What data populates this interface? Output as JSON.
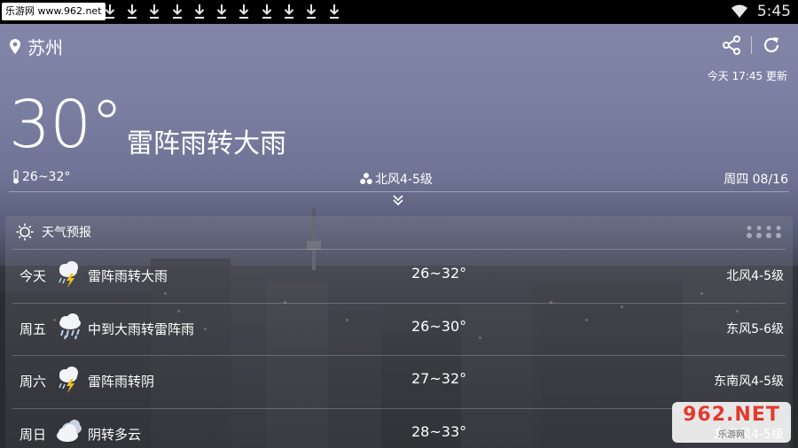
{
  "statusbar": {
    "watermark_url": "乐游网 www.962.net",
    "time": "5:45",
    "download_count": 11
  },
  "header": {
    "city": "苏州",
    "updated": "今天 17:45 更新"
  },
  "current": {
    "temp": "30°",
    "condition": "雷阵雨转大雨",
    "range": "26~32°",
    "wind": "北风4-5级",
    "date": "周四 08/16"
  },
  "forecast": {
    "title": "天气预报",
    "rows": [
      {
        "day": "今天",
        "icon": "thunderstorm-icon",
        "desc": "雷阵雨转大雨",
        "temp": "26~32°",
        "wind": "北风4-5级"
      },
      {
        "day": "周五",
        "icon": "heavy-rain-icon",
        "desc": "中到大雨转雷阵雨",
        "temp": "26~30°",
        "wind": "东风5-6级"
      },
      {
        "day": "周六",
        "icon": "thunderstorm-icon",
        "desc": "雷阵雨转阴",
        "temp": "27~32°",
        "wind": "东南风4-5级"
      },
      {
        "day": "周日",
        "icon": "cloudy-icon",
        "desc": "阴转多云",
        "temp": "28~33°",
        "wind": "东南风4-5级"
      }
    ]
  },
  "watermark": {
    "brand": "962.NET",
    "sub": "乐游网"
  },
  "colors": {
    "sky_top": "#8489ac",
    "ground": "#26272b",
    "watermark_red": "#e23b2e"
  }
}
